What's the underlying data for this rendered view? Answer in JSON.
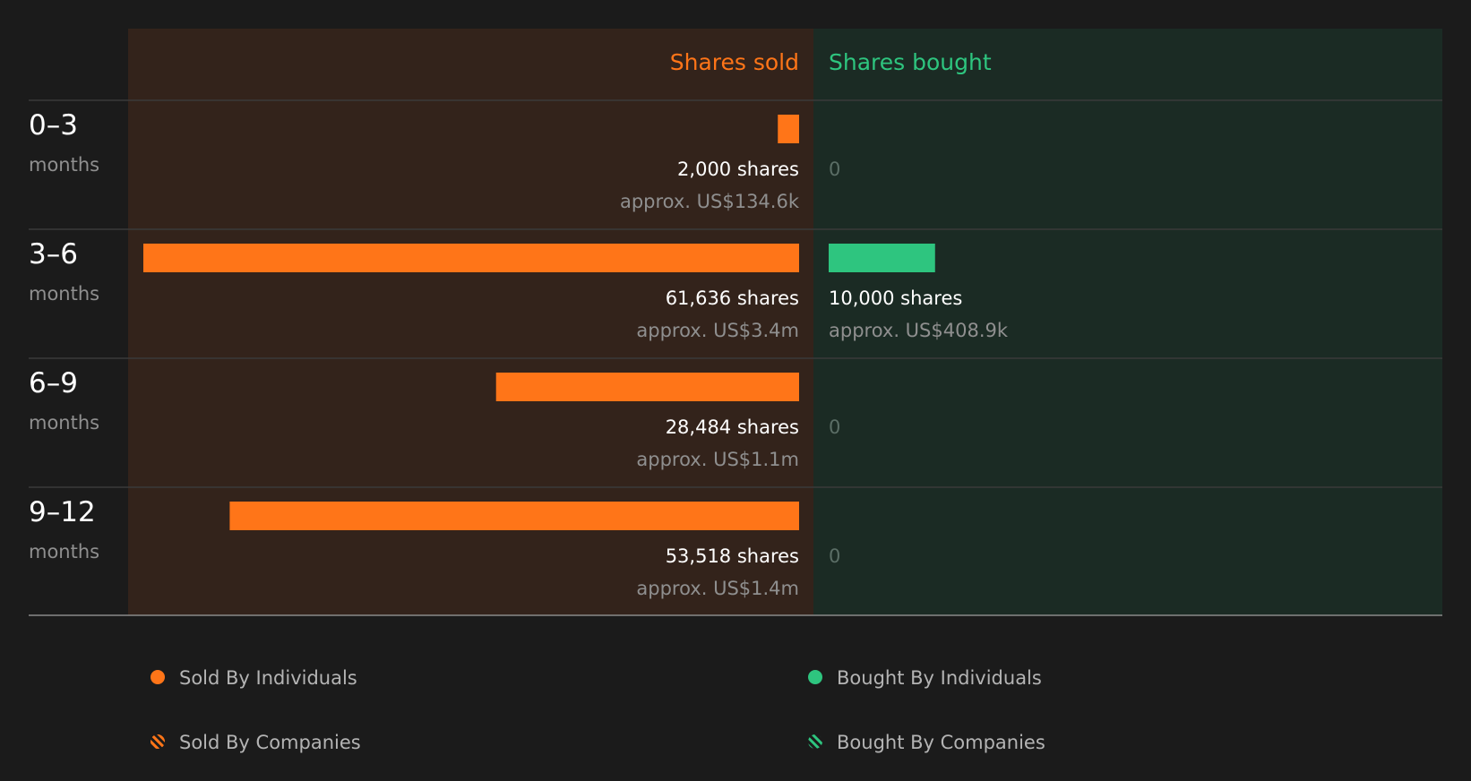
{
  "colors": {
    "page_background": "#1b1b1b",
    "sold": "#ff7518",
    "bought": "#2ec57f",
    "sold_panel": "#33231b",
    "bought_panel": "#1b2b24"
  },
  "chart_data": {
    "type": "bar",
    "orientation": "horizontal-diverging",
    "headers": {
      "sold": "Shares sold",
      "bought": "Shares bought"
    },
    "periods": [
      {
        "range": "0–3",
        "unit": "months",
        "sold": 2000,
        "sold_label": "2,000 shares",
        "sold_value_label": "approx. US$134.6k",
        "bought": 0,
        "bought_label": "0",
        "bought_value_label": ""
      },
      {
        "range": "3–6",
        "unit": "months",
        "sold": 61636,
        "sold_label": "61,636 shares",
        "sold_value_label": "approx. US$3.4m",
        "bought": 10000,
        "bought_label": "10,000 shares",
        "bought_value_label": "approx. US$408.9k"
      },
      {
        "range": "6–9",
        "unit": "months",
        "sold": 28484,
        "sold_label": "28,484 shares",
        "sold_value_label": "approx. US$1.1m",
        "bought": 0,
        "bought_label": "0",
        "bought_value_label": ""
      },
      {
        "range": "9–12",
        "unit": "months",
        "sold": 53518,
        "sold_label": "53,518 shares",
        "sold_value_label": "approx. US$1.4m",
        "bought": 0,
        "bought_label": "0",
        "bought_value_label": ""
      }
    ],
    "max_shares": 61636,
    "legend": [
      {
        "label": "Sold By Individuals",
        "swatch": "solid",
        "color": "#ff7518"
      },
      {
        "label": "Bought By Individuals",
        "swatch": "solid",
        "color": "#2ec57f"
      },
      {
        "label": "Sold By Companies",
        "swatch": "hatched",
        "color": "#ff7518"
      },
      {
        "label": "Bought By Companies",
        "swatch": "hatched",
        "color": "#2ec57f"
      }
    ]
  }
}
